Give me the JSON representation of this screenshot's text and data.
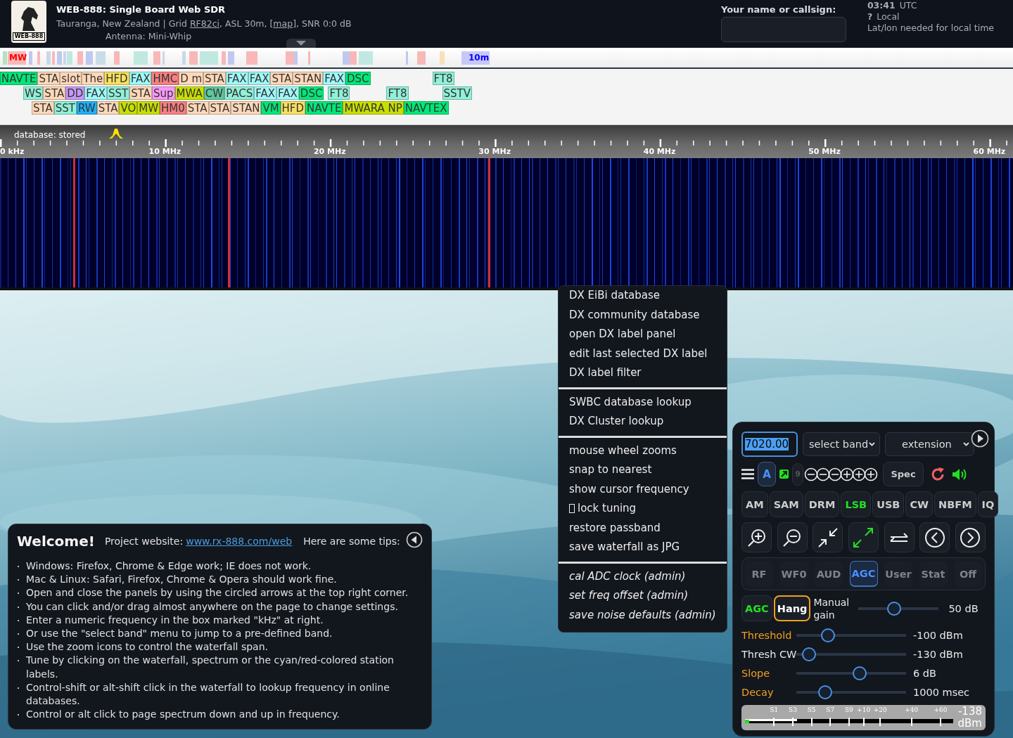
{
  "header": {
    "logo_text": "WEB-888",
    "title": "WEB-888: Single Board Web SDR",
    "location": {
      "prefix": "Tauranga, New Zealand | Grid ",
      "grid_link": "RF82ci",
      "middle": ", ASL 30m, [",
      "map_link": "map",
      "suffix": "], SNR 0:0 dB"
    },
    "antenna": "Antenna: Mini-Whip",
    "callsign": {
      "label": "Your name or callsign:"
    },
    "time": {
      "utc_time": "03:41",
      "utc_label": "UTC",
      "local_time": "?",
      "local_label": "Local",
      "note": "Lat/lon needed for local time"
    }
  },
  "band_bar": {
    "labels": [
      {
        "label": "MW",
        "color": "#ff0000"
      },
      {
        "label": "10m",
        "color": "#0000ff"
      }
    ]
  },
  "dx_labels": {
    "rows": [
      [
        {
          "text": "NAVTE",
          "color": "#00e878"
        },
        {
          "text": "STA",
          "color": "#ffd8b8"
        },
        {
          "text": "slot",
          "color": "#ffd8b8"
        },
        {
          "text": "The",
          "color": "#ffd8b8"
        },
        {
          "text": "HFD",
          "color": "#f8e060"
        },
        {
          "text": "FAX",
          "color": "#a0f8f8"
        },
        {
          "text": "HMC",
          "color": "#f88080"
        },
        {
          "text": "D m",
          "color": "#ffd8b8"
        },
        {
          "text": "STA",
          "color": "#ffd8b8"
        },
        {
          "text": "FAX",
          "color": "#a0f8f8"
        },
        {
          "text": "FAX",
          "color": "#a0f8f8"
        },
        {
          "text": "STA",
          "color": "#ffd8b8"
        },
        {
          "text": "STAN",
          "color": "#ffd8b8"
        },
        {
          "text": "FAX",
          "color": "#a0f8f8"
        },
        {
          "text": "DSC",
          "color": "#00e878"
        },
        {
          "text": "FT8",
          "color": "#90f0d8"
        }
      ],
      [
        {
          "text": "WS",
          "color": "#90f0d8"
        },
        {
          "text": "STA",
          "color": "#ffd8b8"
        },
        {
          "text": "DD",
          "color": "#c898f8"
        },
        {
          "text": "FAX",
          "color": "#a0f8f8"
        },
        {
          "text": "SST",
          "color": "#90f0d8"
        },
        {
          "text": "STA",
          "color": "#ffd8b8"
        },
        {
          "text": "Sup",
          "color": "#f898f8"
        },
        {
          "text": "MWA",
          "color": "#c8e000"
        },
        {
          "text": "CW",
          "color": "#60c8a0"
        },
        {
          "text": "PACS",
          "color": "#90f0d8"
        },
        {
          "text": "FAX",
          "color": "#a0f8f8"
        },
        {
          "text": "FAX",
          "color": "#a0f8f8"
        },
        {
          "text": "DSC",
          "color": "#00e878"
        },
        {
          "text": "FT8",
          "color": "#90f0d8"
        },
        {
          "text": "FT8",
          "color": "#90f0d8"
        },
        {
          "text": "SSTV",
          "color": "#90f0d8"
        }
      ],
      [
        {
          "text": "STA",
          "color": "#ffd8b8"
        },
        {
          "text": "SST",
          "color": "#90f0d8"
        },
        {
          "text": "RW",
          "color": "#20b0f8"
        },
        {
          "text": "STA",
          "color": "#ffd8b8"
        },
        {
          "text": "VO",
          "color": "#c8e000"
        },
        {
          "text": "MW",
          "color": "#c8e000"
        },
        {
          "text": "HM0",
          "color": "#f88080"
        },
        {
          "text": "STA",
          "color": "#ffd8b8"
        },
        {
          "text": "STA",
          "color": "#ffd8b8"
        },
        {
          "text": "STAN",
          "color": "#ffd8b8"
        },
        {
          "text": "VM",
          "color": "#00e878"
        },
        {
          "text": "HFD",
          "color": "#f8e060"
        },
        {
          "text": "NAVTE",
          "color": "#00e878"
        },
        {
          "text": "MWARA NP",
          "color": "#c8e000"
        },
        {
          "text": "NAVTEX",
          "color": "#00e878"
        }
      ]
    ]
  },
  "scale": {
    "status": "database: stored",
    "ticks": [
      "0 kHz",
      "10 MHz",
      "20 MHz",
      "30 MHz",
      "40 MHz",
      "50 MHz",
      "60 MHz"
    ]
  },
  "context_menu": {
    "sections": [
      [
        {
          "label": "DX EiBi database",
          "kind": "item"
        },
        {
          "label": "DX community database",
          "kind": "item"
        },
        {
          "label": "open DX label panel",
          "kind": "item"
        },
        {
          "label": "edit last selected DX label",
          "kind": "item"
        },
        {
          "label": "DX label filter",
          "kind": "item"
        }
      ],
      [
        {
          "label": "SWBC database lookup",
          "kind": "item"
        },
        {
          "label": "DX Cluster lookup",
          "kind": "item"
        }
      ],
      [
        {
          "label": "mouse wheel zooms",
          "kind": "item"
        },
        {
          "label": "snap to nearest",
          "kind": "item"
        },
        {
          "label": "show cursor frequency",
          "kind": "item"
        },
        {
          "label": "lock tuning",
          "kind": "check",
          "checked": false
        },
        {
          "label": "restore passband",
          "kind": "item"
        },
        {
          "label": "save waterfall as JPG",
          "kind": "item"
        }
      ],
      [
        {
          "label": "cal ADC clock (admin)",
          "kind": "admin"
        },
        {
          "label": "set freq offset (admin)",
          "kind": "admin"
        },
        {
          "label": "save noise defaults (admin)",
          "kind": "admin"
        }
      ]
    ]
  },
  "welcome": {
    "title": "Welcome!",
    "website_label": "Project website:",
    "website_link": "www.rx-888.com/web",
    "tips_label": "Here are some tips:",
    "tips": [
      "Windows: Firefox, Chrome & Edge work; IE does not work.",
      "Mac & Linux: Safari, Firefox, Chrome & Opera should work fine.",
      "Open and close the panels by using the circled arrows at the top right corner.",
      "You can click and/or drag almost anywhere on the page to change settings.",
      "Enter a numeric frequency in the box marked \"kHz\" at right.",
      "Or use the \"select band\" menu to jump to a pre-defined band.",
      "Use the zoom icons to control the waterfall span.",
      "Tune by clicking on the waterfall, spectrum or the cyan/red-colored station labels.",
      "Control-shift or alt-shift click in the waterfall to lookup frequency in online databases.",
      "Control or alt click to page spectrum down and up in frequency."
    ]
  },
  "control_panel": {
    "frequency": {
      "value": "7020.00"
    },
    "band_select": "select band",
    "extension_select": "extension",
    "vfo": {
      "label": "A",
      "selected": true
    },
    "step": {
      "label": "9",
      "disabled": true
    },
    "spec": "Spec",
    "modes": [
      {
        "label": "AM",
        "selected": false
      },
      {
        "label": "SAM",
        "selected": false
      },
      {
        "label": "DRM",
        "selected": false
      },
      {
        "label": "LSB",
        "selected": true
      },
      {
        "label": "USB",
        "selected": false
      },
      {
        "label": "CW",
        "selected": false
      },
      {
        "label": "NBFM",
        "selected": false
      },
      {
        "label": "IQ",
        "selected": false
      }
    ],
    "tabs": [
      {
        "label": "RF",
        "selected": false
      },
      {
        "label": "WF0",
        "selected": false
      },
      {
        "label": "AUD",
        "selected": false
      },
      {
        "label": "AGC",
        "selected": true
      },
      {
        "label": "User",
        "selected": false
      },
      {
        "label": "Stat",
        "selected": false
      },
      {
        "label": "Off",
        "selected": false
      }
    ],
    "agc_button": {
      "label": "AGC",
      "on": true
    },
    "hang_button": {
      "label": "Hang",
      "on": true
    },
    "manual_gain": {
      "label": "Manual gain",
      "level": 0.43,
      "reading": "50 dB"
    },
    "sliders": [
      {
        "label": "Threshold",
        "active": true,
        "level": 0.26,
        "reading": "-100 dBm"
      },
      {
        "label": "Thresh CW",
        "active": false,
        "level": 0.06,
        "reading": "-130 dBm"
      },
      {
        "label": "Slope",
        "active": true,
        "level": 0.59,
        "reading": "6 dB"
      },
      {
        "label": "Decay",
        "active": true,
        "level": 0.23,
        "reading": "1000 msec"
      }
    ],
    "s_meter": {
      "scale": [
        "S1",
        "S3",
        "S5",
        "S7",
        "S9",
        "+10",
        "+20",
        "+40",
        "+60"
      ],
      "level": 0.02,
      "peak": {
        "level": 0.25
      },
      "reading": "-138 dBm"
    }
  }
}
